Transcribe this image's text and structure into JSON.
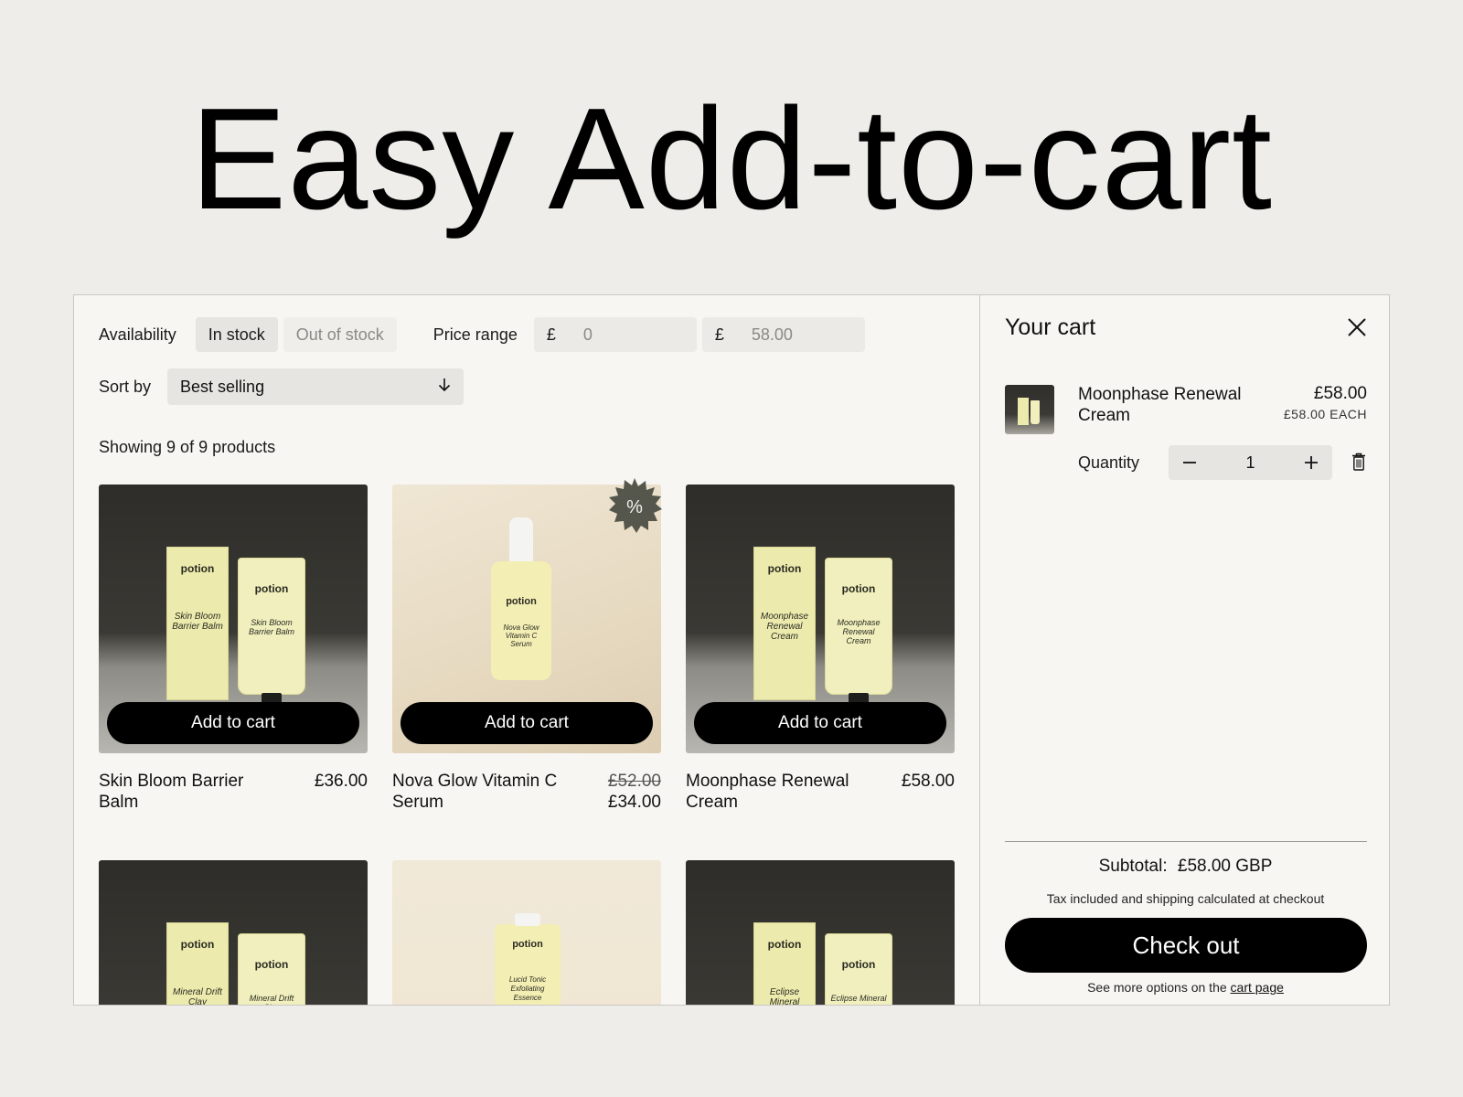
{
  "hero": {
    "title": "Easy Add-to-cart"
  },
  "filters": {
    "availability_label": "Availability",
    "in_stock": "In stock",
    "out_of_stock": "Out of stock",
    "price_range_label": "Price range",
    "currency": "£",
    "price_min": "0",
    "price_max": "58.00",
    "sort_label": "Sort by",
    "sort_value": "Best selling",
    "count_text": "Showing 9 of 9 products"
  },
  "products": [
    {
      "name": "Skin Bloom Barrier Balm",
      "price": "£36.00",
      "box_label": "Skin Bloom Barrier Balm",
      "brand": "potion",
      "button": "Add to cart"
    },
    {
      "name": "Nova Glow Vitamin C Serum",
      "old_price": "£52.00",
      "price": "£34.00",
      "box_label": "Nova Glow Vitamin C Serum",
      "brand": "potion",
      "button": "Add to cart",
      "badge": "%"
    },
    {
      "name": "Moonphase Renewal Cream",
      "price": "£58.00",
      "box_label": "Moonphase Renewal Cream",
      "brand": "potion",
      "button": "Add to cart"
    },
    {
      "box_label": "Mineral Drift Clay",
      "brand": "potion"
    },
    {
      "box_label": "Lucid Tonic Exfoliating Essence",
      "brand": "potion"
    },
    {
      "box_label": "Eclipse Mineral",
      "brand": "potion"
    }
  ],
  "cart": {
    "title": "Your cart",
    "item": {
      "name": "Moonphase Renewal Cream",
      "price": "£58.00",
      "each": "£58.00 EACH",
      "quantity": "1"
    },
    "quantity_label": "Quantity",
    "subtotal_label": "Subtotal:",
    "subtotal_value": "£58.00 GBP",
    "tax_note": "Tax included and shipping calculated at checkout",
    "checkout": "Check out",
    "more_prefix": "See more options on the",
    "more_link": "cart page"
  },
  "colors": {
    "background": "#eeede9",
    "panel": "#f7f6f3",
    "accent": "#000000",
    "product": "#ecebad"
  }
}
